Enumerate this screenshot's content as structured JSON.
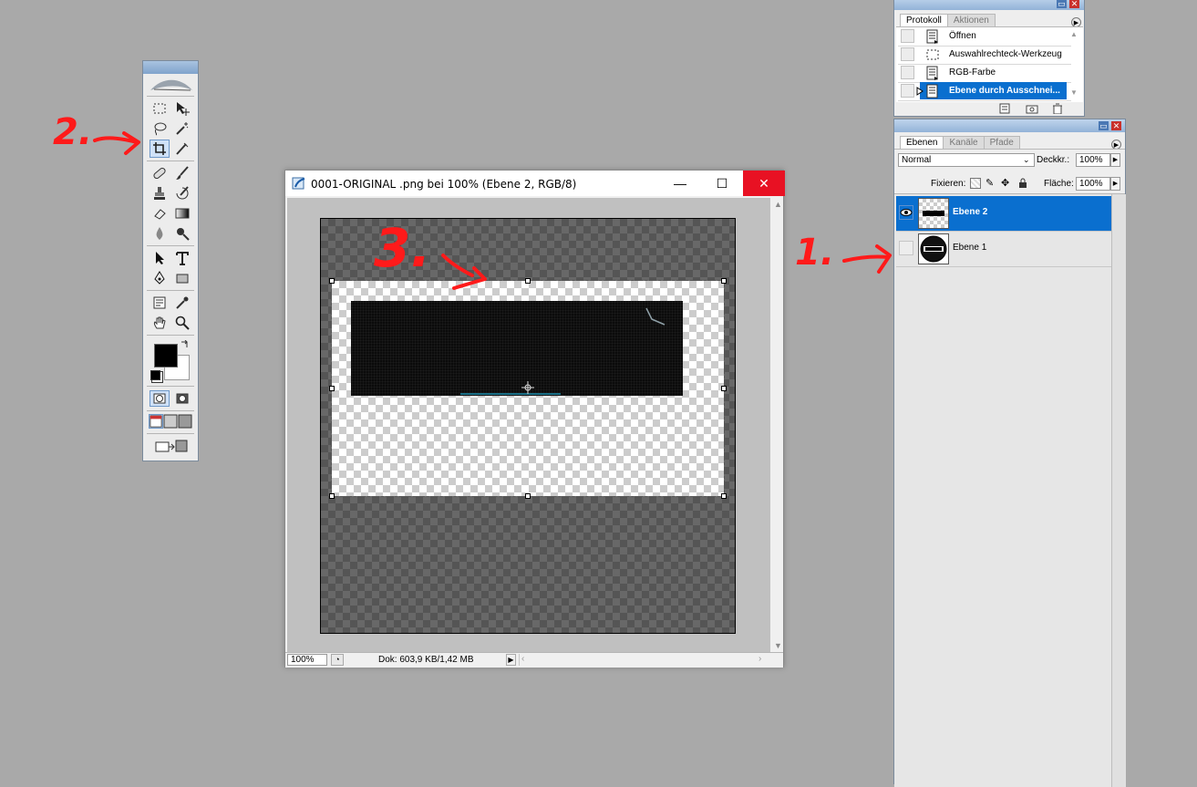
{
  "document": {
    "title": "0001-ORIGINAL .png bei 100% (Ebene 2, RGB/8)",
    "zoom": "100%",
    "doc_info": "Dok: 603,9 KB/1,42 MB",
    "minimize": "—",
    "maximize": "☐",
    "close": "✕"
  },
  "history": {
    "tabs": [
      "Protokoll",
      "Aktionen"
    ],
    "items": [
      {
        "label": "Öffnen"
      },
      {
        "label": "Auswahlrechteck-Werkzeug"
      },
      {
        "label": "RGB-Farbe"
      },
      {
        "label": "Ebene durch Ausschnei..."
      }
    ]
  },
  "layers": {
    "tabs": [
      "Ebenen",
      "Kanäle",
      "Pfade"
    ],
    "blend_mode": "Normal",
    "opacity_label": "Deckkr.:",
    "opacity_value": "100%",
    "lock_label": "Fixieren:",
    "fill_label": "Fläche:",
    "fill_value": "100%",
    "items": [
      {
        "name": "Ebene 2"
      },
      {
        "name": "Ebene 1"
      }
    ]
  },
  "annotations": {
    "one": "1.",
    "two": "2.",
    "three": "3."
  },
  "colors": {
    "selection": "#0a6fcf",
    "annotation": "#ff1a1a",
    "close_button": "#e81123"
  }
}
